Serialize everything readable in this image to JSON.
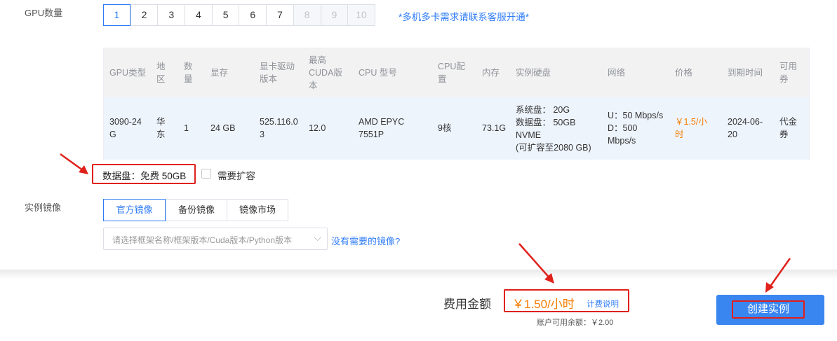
{
  "gpu_count": {
    "label": "GPU数量",
    "options": [
      "1",
      "2",
      "3",
      "4",
      "5",
      "6",
      "7",
      "8",
      "9",
      "10"
    ],
    "selected": "1",
    "disabled_from": "8",
    "note": "*多机多卡需求请联系客服开通*"
  },
  "table": {
    "headers": {
      "type": "GPU类型",
      "region_l1": "地",
      "region_l2": "区",
      "count_l1": "数",
      "count_l2": "量",
      "vram": "显存",
      "driver_l1": "显卡驱动",
      "driver_l2": "版本",
      "cuda_l1": "最高",
      "cuda_l2": "CUDA版",
      "cuda_l3": "本",
      "cpu_model": "CPU 型号",
      "cpu_cfg_l1": "CPU配",
      "cpu_cfg_l2": "置",
      "memory": "内存",
      "disk": "实例硬盘",
      "network": "网络",
      "price": "价格",
      "expire": "到期时间",
      "voucher_l1": "可用",
      "voucher_l2": "券"
    },
    "row": {
      "type_l1": "3090-24",
      "type_l2": "G",
      "region_l1": "华",
      "region_l2": "东",
      "count": "1",
      "vram": "24 GB",
      "driver_l1": "525.116.0",
      "driver_l2": "3",
      "cuda": "12.0",
      "cpu_model_l1": "AMD EPYC",
      "cpu_model_l2": "7551P",
      "cpu_cfg": "9核",
      "memory": "73.1G",
      "disk_l1": "系统盘： 20G",
      "disk_l2": "数据盘： 50GB",
      "disk_l3": "NVME",
      "disk_l4": "(可扩容至2080 GB)",
      "net_l1": "U：50 Mbps/s",
      "net_l2": "D：500",
      "net_l3": "Mbps/s",
      "price_l1": "￥1.5/小",
      "price_l2": "时",
      "expire_l1": "2024-06-",
      "expire_l2": "20",
      "voucher_l1": "代金",
      "voucher_l2": "券"
    }
  },
  "data_disk": {
    "label": "数据盘：免费 50GB",
    "expand_label": "需要扩容",
    "expand_checked": false
  },
  "image": {
    "label": "实例镜像",
    "tabs": [
      "官方镜像",
      "备份镜像",
      "镜像市场"
    ],
    "active_tab": "官方镜像",
    "select_placeholder": "请选择框架名称/框架版本/Cuda版本/Python版本",
    "missing_link": "没有需要的镜像?"
  },
  "footer": {
    "cost_label": "费用金额",
    "cost_value": "￥1.50/小时",
    "billing_link": "计费说明",
    "balance": "账户可用余额：￥2.00",
    "create_button": "创建实例"
  },
  "colors": {
    "accent": "#2f7cf6",
    "price": "#f57c00",
    "highlight": "#e0201b",
    "button": "#3a86f0"
  }
}
